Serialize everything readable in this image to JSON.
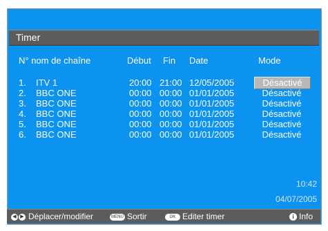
{
  "header": {
    "title": "Timer"
  },
  "columns": {
    "num_name": "N° nom de chaîne",
    "debut": "Début",
    "fin": "Fin",
    "date": "Date",
    "mode": "Mode"
  },
  "rows": [
    {
      "num": "1.",
      "channel": "ITV 1",
      "debut": "20:00",
      "fin": "21:00",
      "date": "12/05/2005",
      "mode": "Désactivé",
      "selected": true
    },
    {
      "num": "2.",
      "channel": "BBC ONE",
      "debut": "00:00",
      "fin": "00:00",
      "date": "01/01/2005",
      "mode": "Désactivé"
    },
    {
      "num": "3.",
      "channel": "BBC ONE",
      "debut": "00:00",
      "fin": "00:00",
      "date": "01/01/2005",
      "mode": "Désactivé"
    },
    {
      "num": "4.",
      "channel": "BBC ONE",
      "debut": "00:00",
      "fin": "00:00",
      "date": "01/01/2005",
      "mode": "Désactivé"
    },
    {
      "num": "5.",
      "channel": "BBC ONE",
      "debut": "00:00",
      "fin": "00:00",
      "date": "01/01/2005",
      "mode": "Désactivé"
    },
    {
      "num": "6.",
      "channel": "BBC ONE",
      "debut": "00:00",
      "fin": "00:00",
      "date": "01/01/2005",
      "mode": "Désactivé"
    }
  ],
  "clock": {
    "time": "10:42",
    "date": "04/07/2005"
  },
  "footer": {
    "move_label": "Déplacer/modifier",
    "menu_icon_text": "MENU",
    "exit_label": "Sortir",
    "ok_icon_text": "OK",
    "edit_label": "Editer timer",
    "info_icon_text": "i",
    "info_label": "Info"
  },
  "colors": {
    "background": "#0c93f0",
    "bar": "#5c5c5c",
    "selected_bg": "#b8b8b8"
  },
  "icons": {
    "move": "left-right-arrows-icon",
    "menu": "menu-button-icon",
    "ok": "ok-button-icon",
    "info": "info-icon"
  }
}
